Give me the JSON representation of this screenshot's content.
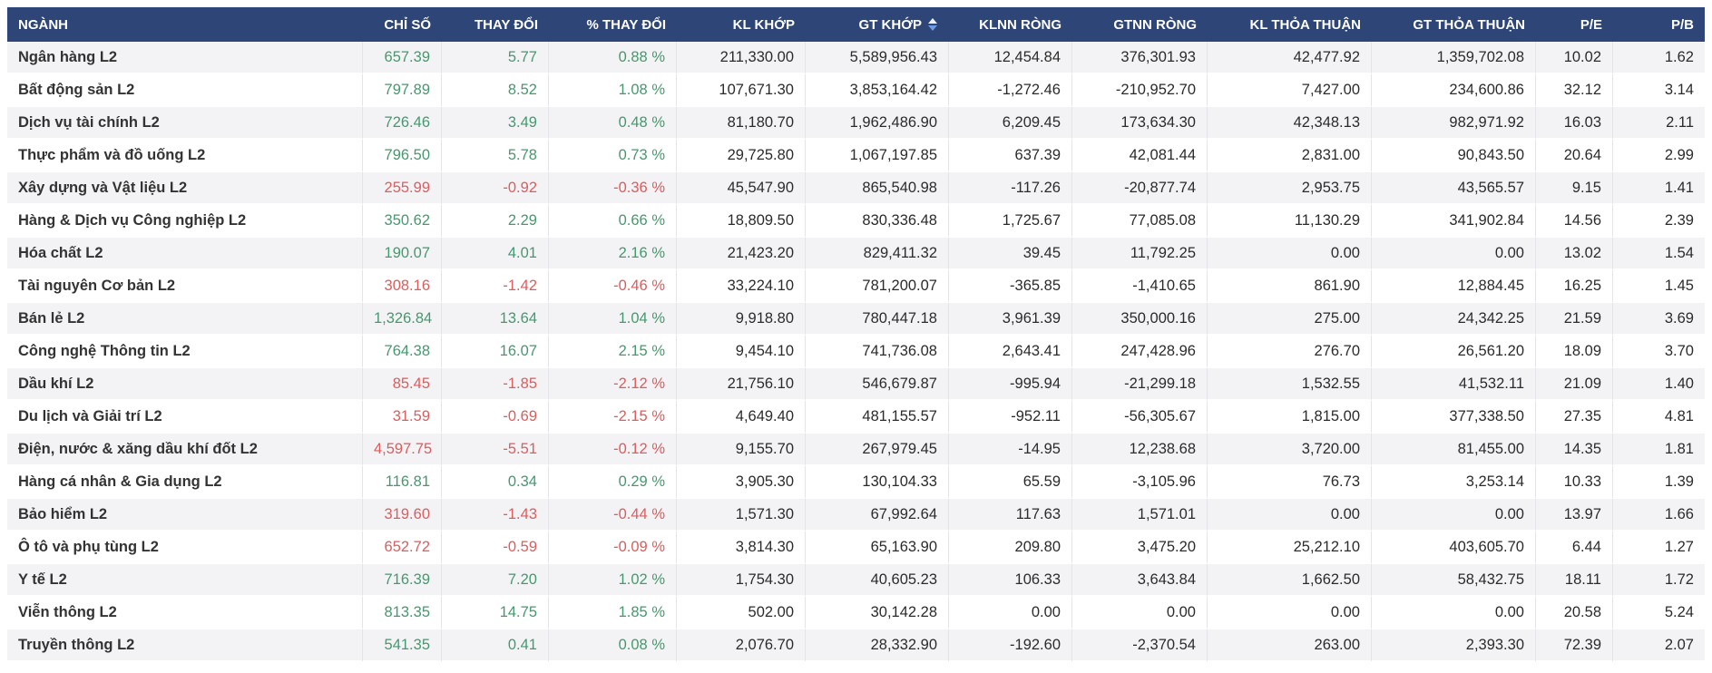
{
  "colors": {
    "header_bg": "#2e4577",
    "header_text": "#ffffff",
    "stripe_bg": "#f3f3f6",
    "up_text": "#45996e",
    "down_text": "#dd5c5c",
    "sort_arrow_active": "#6f9ce0"
  },
  "table": {
    "sort": {
      "column": "gt_khop",
      "icon": "sort-arrows-icon"
    },
    "columns": [
      {
        "key": "name",
        "label": "NGÀNH",
        "align": "left",
        "colored": false
      },
      {
        "key": "chi_so",
        "label": "CHỈ SỐ",
        "align": "right",
        "colored": true
      },
      {
        "key": "thay_doi",
        "label": "THAY ĐỔI",
        "align": "right",
        "colored": true
      },
      {
        "key": "pct",
        "label": "% THAY ĐỔI",
        "align": "right",
        "colored": true
      },
      {
        "key": "kl_khop",
        "label": "KL KHỚP",
        "align": "right",
        "colored": false
      },
      {
        "key": "gt_khop",
        "label": "GT KHỚP",
        "align": "right",
        "colored": false,
        "sorted": true
      },
      {
        "key": "klnn",
        "label": "KLNN RÒNG",
        "align": "right",
        "colored": false
      },
      {
        "key": "gtnn",
        "label": "GTNN RÒNG",
        "align": "right",
        "colored": false
      },
      {
        "key": "kl_tt",
        "label": "KL THỎA THUẬN",
        "align": "right",
        "colored": false
      },
      {
        "key": "gt_tt",
        "label": "GT THỎA THUẬN",
        "align": "right",
        "colored": false
      },
      {
        "key": "pe",
        "label": "P/E",
        "align": "right",
        "colored": false
      },
      {
        "key": "pb",
        "label": "P/B",
        "align": "right",
        "colored": false
      }
    ],
    "rows": [
      {
        "name": "Ngân hàng L2",
        "trend": "up",
        "chi_so": "657.39",
        "thay_doi": "5.77",
        "pct": "0.88 %",
        "kl_khop": "211,330.00",
        "gt_khop": "5,589,956.43",
        "klnn": "12,454.84",
        "gtnn": "376,301.93",
        "kl_tt": "42,477.92",
        "gt_tt": "1,359,702.08",
        "pe": "10.02",
        "pb": "1.62"
      },
      {
        "name": "Bất động sản L2",
        "trend": "up",
        "chi_so": "797.89",
        "thay_doi": "8.52",
        "pct": "1.08 %",
        "kl_khop": "107,671.30",
        "gt_khop": "3,853,164.42",
        "klnn": "-1,272.46",
        "gtnn": "-210,952.70",
        "kl_tt": "7,427.00",
        "gt_tt": "234,600.86",
        "pe": "32.12",
        "pb": "3.14"
      },
      {
        "name": "Dịch vụ tài chính L2",
        "trend": "up",
        "chi_so": "726.46",
        "thay_doi": "3.49",
        "pct": "0.48 %",
        "kl_khop": "81,180.70",
        "gt_khop": "1,962,486.90",
        "klnn": "6,209.45",
        "gtnn": "173,634.30",
        "kl_tt": "42,348.13",
        "gt_tt": "982,971.92",
        "pe": "16.03",
        "pb": "2.11"
      },
      {
        "name": "Thực phẩm và đồ uống L2",
        "trend": "up",
        "chi_so": "796.50",
        "thay_doi": "5.78",
        "pct": "0.73 %",
        "kl_khop": "29,725.80",
        "gt_khop": "1,067,197.85",
        "klnn": "637.39",
        "gtnn": "42,081.44",
        "kl_tt": "2,831.00",
        "gt_tt": "90,843.50",
        "pe": "20.64",
        "pb": "2.99"
      },
      {
        "name": "Xây dựng và Vật liệu L2",
        "trend": "down",
        "chi_so": "255.99",
        "thay_doi": "-0.92",
        "pct": "-0.36 %",
        "kl_khop": "45,547.90",
        "gt_khop": "865,540.98",
        "klnn": "-117.26",
        "gtnn": "-20,877.74",
        "kl_tt": "2,953.75",
        "gt_tt": "43,565.57",
        "pe": "9.15",
        "pb": "1.41"
      },
      {
        "name": "Hàng & Dịch vụ Công nghiệp L2",
        "trend": "up",
        "chi_so": "350.62",
        "thay_doi": "2.29",
        "pct": "0.66 %",
        "kl_khop": "18,809.50",
        "gt_khop": "830,336.48",
        "klnn": "1,725.67",
        "gtnn": "77,085.08",
        "kl_tt": "11,130.29",
        "gt_tt": "341,902.84",
        "pe": "14.56",
        "pb": "2.39"
      },
      {
        "name": "Hóa chất L2",
        "trend": "up",
        "chi_so": "190.07",
        "thay_doi": "4.01",
        "pct": "2.16 %",
        "kl_khop": "21,423.20",
        "gt_khop": "829,411.32",
        "klnn": "39.45",
        "gtnn": "11,792.25",
        "kl_tt": "0.00",
        "gt_tt": "0.00",
        "pe": "13.02",
        "pb": "1.54"
      },
      {
        "name": "Tài nguyên Cơ bản L2",
        "trend": "down",
        "chi_so": "308.16",
        "thay_doi": "-1.42",
        "pct": "-0.46 %",
        "kl_khop": "33,224.10",
        "gt_khop": "781,200.07",
        "klnn": "-365.85",
        "gtnn": "-1,410.65",
        "kl_tt": "861.90",
        "gt_tt": "12,884.45",
        "pe": "16.25",
        "pb": "1.45"
      },
      {
        "name": "Bán lẻ L2",
        "trend": "up",
        "chi_so": "1,326.84",
        "thay_doi": "13.64",
        "pct": "1.04 %",
        "kl_khop": "9,918.80",
        "gt_khop": "780,447.18",
        "klnn": "3,961.39",
        "gtnn": "350,000.16",
        "kl_tt": "275.00",
        "gt_tt": "24,342.25",
        "pe": "21.59",
        "pb": "3.69"
      },
      {
        "name": "Công nghệ Thông tin L2",
        "trend": "up",
        "chi_so": "764.38",
        "thay_doi": "16.07",
        "pct": "2.15 %",
        "kl_khop": "9,454.10",
        "gt_khop": "741,736.08",
        "klnn": "2,643.41",
        "gtnn": "247,428.96",
        "kl_tt": "276.70",
        "gt_tt": "26,561.20",
        "pe": "18.09",
        "pb": "3.70"
      },
      {
        "name": "Dầu khí L2",
        "trend": "down",
        "chi_so": "85.45",
        "thay_doi": "-1.85",
        "pct": "-2.12 %",
        "kl_khop": "21,756.10",
        "gt_khop": "546,679.87",
        "klnn": "-995.94",
        "gtnn": "-21,299.18",
        "kl_tt": "1,532.55",
        "gt_tt": "41,532.11",
        "pe": "21.09",
        "pb": "1.40"
      },
      {
        "name": "Du lịch và Giải trí L2",
        "trend": "down",
        "chi_so": "31.59",
        "thay_doi": "-0.69",
        "pct": "-2.15 %",
        "kl_khop": "4,649.40",
        "gt_khop": "481,155.57",
        "klnn": "-952.11",
        "gtnn": "-56,305.67",
        "kl_tt": "1,815.00",
        "gt_tt": "377,338.50",
        "pe": "27.35",
        "pb": "4.81"
      },
      {
        "name": "Điện, nước & xăng dầu khí đốt L2",
        "trend": "down",
        "chi_so": "4,597.75",
        "thay_doi": "-5.51",
        "pct": "-0.12 %",
        "kl_khop": "9,155.70",
        "gt_khop": "267,979.45",
        "klnn": "-14.95",
        "gtnn": "12,238.68",
        "kl_tt": "3,720.00",
        "gt_tt": "81,455.00",
        "pe": "14.35",
        "pb": "1.81"
      },
      {
        "name": "Hàng cá nhân & Gia dụng L2",
        "trend": "up",
        "chi_so": "116.81",
        "thay_doi": "0.34",
        "pct": "0.29 %",
        "kl_khop": "3,905.30",
        "gt_khop": "130,104.33",
        "klnn": "65.59",
        "gtnn": "-3,105.96",
        "kl_tt": "76.73",
        "gt_tt": "3,253.14",
        "pe": "10.33",
        "pb": "1.39"
      },
      {
        "name": "Bảo hiểm L2",
        "trend": "down",
        "chi_so": "319.60",
        "thay_doi": "-1.43",
        "pct": "-0.44 %",
        "kl_khop": "1,571.30",
        "gt_khop": "67,992.64",
        "klnn": "117.63",
        "gtnn": "1,571.01",
        "kl_tt": "0.00",
        "gt_tt": "0.00",
        "pe": "13.97",
        "pb": "1.66"
      },
      {
        "name": "Ô tô và phụ tùng L2",
        "trend": "down",
        "chi_so": "652.72",
        "thay_doi": "-0.59",
        "pct": "-0.09 %",
        "kl_khop": "3,814.30",
        "gt_khop": "65,163.90",
        "klnn": "209.80",
        "gtnn": "3,475.20",
        "kl_tt": "25,212.10",
        "gt_tt": "403,605.70",
        "pe": "6.44",
        "pb": "1.27"
      },
      {
        "name": "Y tế L2",
        "trend": "up",
        "chi_so": "716.39",
        "thay_doi": "7.20",
        "pct": "1.02 %",
        "kl_khop": "1,754.30",
        "gt_khop": "40,605.23",
        "klnn": "106.33",
        "gtnn": "3,643.84",
        "kl_tt": "1,662.50",
        "gt_tt": "58,432.75",
        "pe": "18.11",
        "pb": "1.72"
      },
      {
        "name": "Viễn thông L2",
        "trend": "up",
        "chi_so": "813.35",
        "thay_doi": "14.75",
        "pct": "1.85 %",
        "kl_khop": "502.00",
        "gt_khop": "30,142.28",
        "klnn": "0.00",
        "gtnn": "0.00",
        "kl_tt": "0.00",
        "gt_tt": "0.00",
        "pe": "20.58",
        "pb": "5.24"
      },
      {
        "name": "Truyền thông L2",
        "trend": "up",
        "chi_so": "541.35",
        "thay_doi": "0.41",
        "pct": "0.08 %",
        "kl_khop": "2,076.70",
        "gt_khop": "28,332.90",
        "klnn": "-192.60",
        "gtnn": "-2,370.54",
        "kl_tt": "263.00",
        "gt_tt": "2,393.30",
        "pe": "72.39",
        "pb": "2.07"
      }
    ]
  }
}
